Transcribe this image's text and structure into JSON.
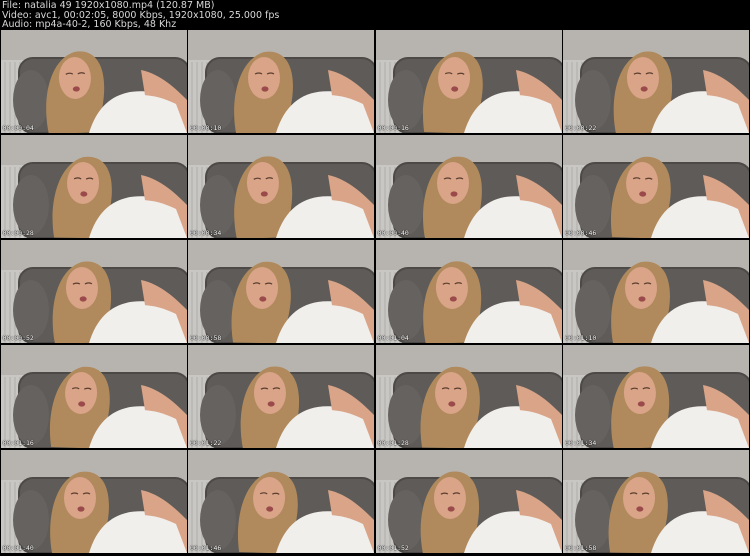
{
  "header": {
    "file_line": "File: natalia 49 1920x1080.mp4 (120.87 MB)",
    "video_line": "Video: avc1, 00:02:05, 8000 Kbps, 1920x1080, 25.000 fps",
    "audio_line": "Audio: mp4a-40-2, 160 Kbps, 48 Khz"
  },
  "thumbnails": [
    {
      "timestamp": "00:00:04"
    },
    {
      "timestamp": "00:00:10"
    },
    {
      "timestamp": "00:00:16"
    },
    {
      "timestamp": "00:00:22"
    },
    {
      "timestamp": "00:00:28"
    },
    {
      "timestamp": "00:00:34"
    },
    {
      "timestamp": "00:00:40"
    },
    {
      "timestamp": "00:00:46"
    },
    {
      "timestamp": "00:00:52"
    },
    {
      "timestamp": "00:00:58"
    },
    {
      "timestamp": "00:01:04"
    },
    {
      "timestamp": "00:01:10"
    },
    {
      "timestamp": "00:01:16"
    },
    {
      "timestamp": "00:01:22"
    },
    {
      "timestamp": "00:01:28"
    },
    {
      "timestamp": "00:01:34"
    },
    {
      "timestamp": "00:01:40"
    },
    {
      "timestamp": "00:01:46"
    },
    {
      "timestamp": "00:01:52"
    },
    {
      "timestamp": "00:01:58"
    }
  ],
  "colors": {
    "background": "#000000",
    "header_text": "#d8d8d8",
    "sofa": "#5e5b58",
    "wall": "#b7b4b0",
    "dress": "#f1efec",
    "hair": "#b08a5c",
    "skin": "#d9a487"
  }
}
